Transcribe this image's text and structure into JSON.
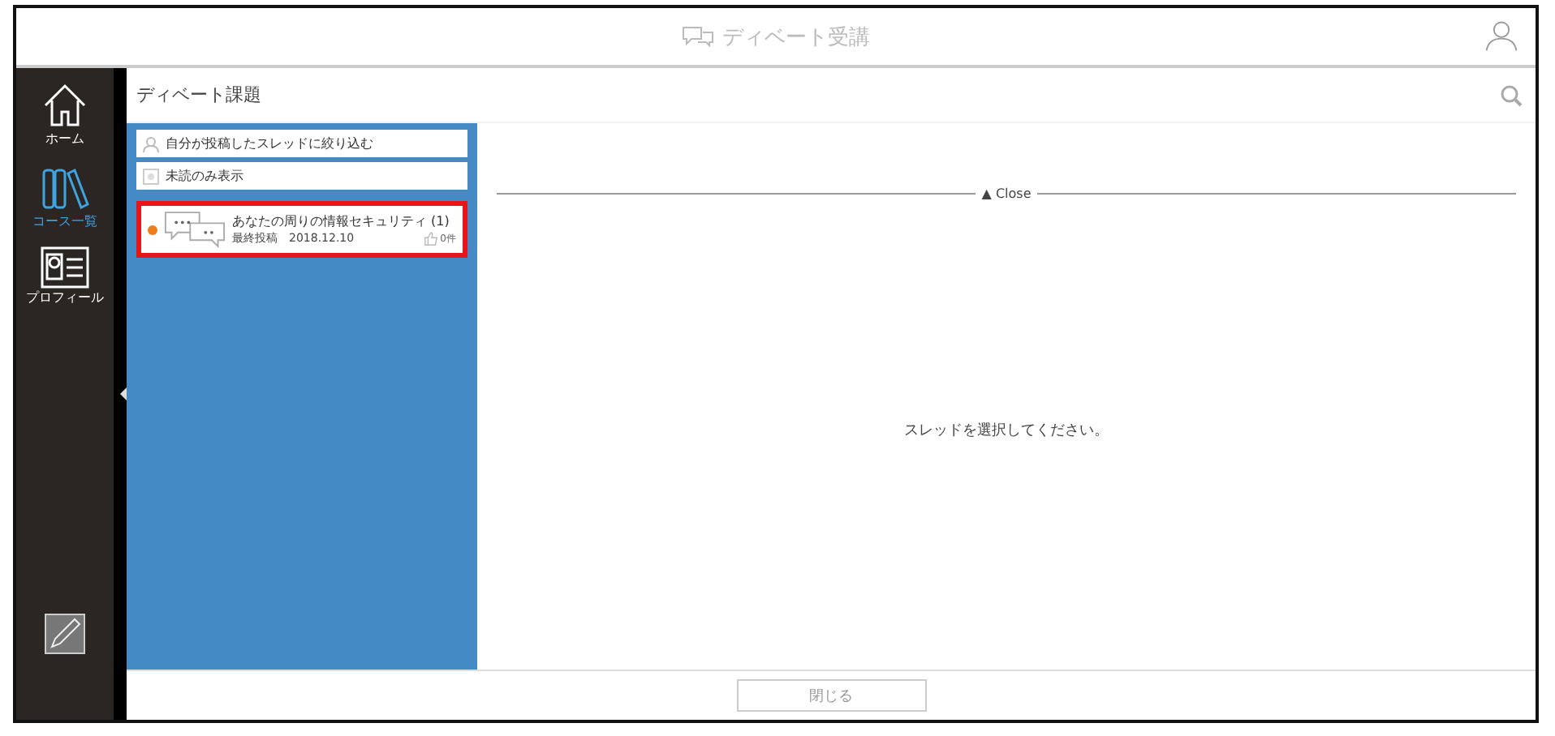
{
  "header": {
    "title": "ディベート受講"
  },
  "sidebar": {
    "items": [
      {
        "kind": "home",
        "label": "ホーム",
        "selected": false
      },
      {
        "kind": "books",
        "label": "コース一覧",
        "selected": true
      },
      {
        "kind": "profile",
        "label": "プロフィール",
        "selected": false
      }
    ]
  },
  "page": {
    "title": "ディベート課題"
  },
  "filters": [
    {
      "kind": "person",
      "label": "自分が投稿したスレッドに絞り込む"
    },
    {
      "kind": "circle",
      "label": "未読のみ表示"
    }
  ],
  "threads": [
    {
      "title": "あなたの周りの情報セキュリティ (1)",
      "meta": "最終投稿　2018.12.10",
      "likes": "0件",
      "unread": true,
      "highlighted": true
    }
  ],
  "detail": {
    "close_label": "▲ Close",
    "message": "スレッドを選択してください。"
  },
  "footer": {
    "button": "閉じる"
  }
}
